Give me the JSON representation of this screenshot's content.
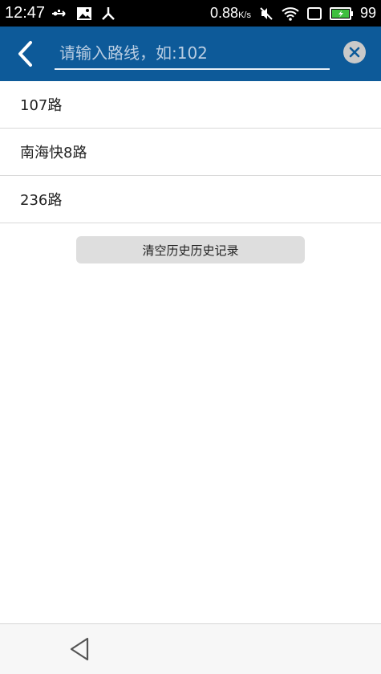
{
  "status_bar": {
    "time": "12:47",
    "speed": "0.88",
    "speed_unit": "K/s",
    "battery": "99",
    "left_icons": [
      "usb-icon",
      "image-icon",
      "share-node-icon"
    ],
    "right_icons": [
      "mute-icon",
      "wifi-icon",
      "screen-icon",
      "battery-charging-icon"
    ]
  },
  "app_bar": {
    "search_placeholder": "请输入路线，如:102",
    "back_icon": "chevron-left-icon",
    "clear_icon": "close-circle-icon",
    "accent_color": "#0d5a99"
  },
  "history": {
    "items": [
      "107路",
      "南海快8路",
      "236路"
    ],
    "clear_label": "清空历史历史记录"
  },
  "nav_bar": {
    "back_icon": "triangle-back-icon"
  }
}
